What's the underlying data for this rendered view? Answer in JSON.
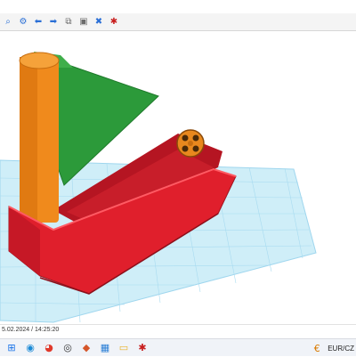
{
  "toolbar": {
    "buttons": [
      {
        "icon": "zoom-icon",
        "glyph": "⌕"
      },
      {
        "icon": "settings-icon",
        "glyph": "⚙"
      },
      {
        "icon": "arrow-left-icon",
        "glyph": "⬅"
      },
      {
        "icon": "arrow-right-icon",
        "glyph": "➡"
      },
      {
        "icon": "copy-icon",
        "glyph": "⧉"
      },
      {
        "icon": "paste-icon",
        "glyph": "▣"
      },
      {
        "icon": "tools-icon",
        "glyph": "✖"
      },
      {
        "icon": "puzzle-icon",
        "glyph": "✱"
      }
    ]
  },
  "scene": {
    "description_colors": {
      "grid_bg": "#cfeef8",
      "grid_line": "#9fd6ee",
      "hull": "#e01f2c",
      "hull_dark": "#b51522",
      "mast": "#f08a1c",
      "sail": "#2c9a3a",
      "wheel": "#e8881e"
    }
  },
  "status": {
    "timestamp": "5.02.2024 / 14:25:20"
  },
  "taskbar": {
    "apps": [
      {
        "icon": "windows-start-icon",
        "glyph": "⊞"
      },
      {
        "icon": "edge-browser-icon",
        "glyph": "◉"
      },
      {
        "icon": "chrome-browser-icon",
        "glyph": "◕"
      },
      {
        "icon": "media-app-icon",
        "glyph": "◎"
      },
      {
        "icon": "app-icon",
        "glyph": "◆"
      },
      {
        "icon": "tinkercad-icon",
        "glyph": "▦"
      },
      {
        "icon": "file-explorer-icon",
        "glyph": "▭"
      },
      {
        "icon": "puzzle-app-icon",
        "glyph": "✱"
      }
    ],
    "tray_label": "EUR/CZ"
  }
}
